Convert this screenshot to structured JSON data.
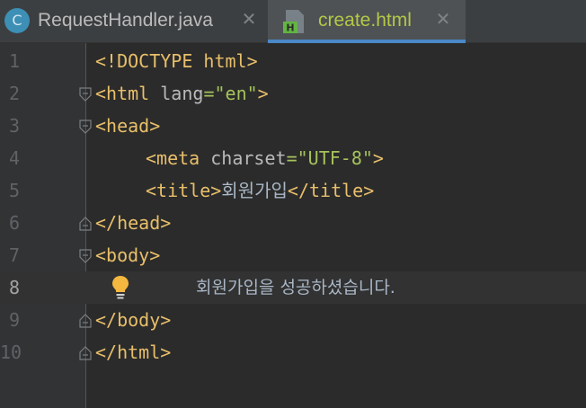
{
  "tabs": [
    {
      "label": "RequestHandler.java",
      "icon": "class-c-icon",
      "icon_letter": "C",
      "active": false
    },
    {
      "label": "create.html",
      "icon": "html-file-icon",
      "icon_letter": "H",
      "active": true
    }
  ],
  "editor": {
    "line_numbers": [
      "1",
      "2",
      "3",
      "4",
      "5",
      "6",
      "7",
      "8",
      "9",
      "10"
    ],
    "current_line": 8,
    "lines": {
      "l1": {
        "tag": "<!DOCTYPE html>"
      },
      "l2": {
        "open": "<html",
        "attr": "lang",
        "eq": "=",
        "value": "\"en\"",
        "close": ">"
      },
      "l3": {
        "tag": "<head>"
      },
      "l4": {
        "open": "<meta",
        "attr": "charset",
        "eq": "=",
        "value": "\"UTF-8\"",
        "close": ">"
      },
      "l5": {
        "open": "<title>",
        "text": "회원가입",
        "close": "</title>"
      },
      "l6": {
        "tag": "</head>"
      },
      "l7": {
        "tag": "<body>"
      },
      "l8": {
        "text": "회원가입을 성공하셨습니다."
      },
      "l9": {
        "tag": "</body>"
      },
      "l10": {
        "tag": "</html>"
      }
    }
  },
  "colors": {
    "background": "#2b2b2b",
    "gutter": "#313335",
    "tag": "#e8bf6a",
    "attribute_value": "#a5c25c",
    "text": "#a9b7c6",
    "active_tab_label": "#b4c847",
    "active_tab_underline": "#4a88c7"
  }
}
